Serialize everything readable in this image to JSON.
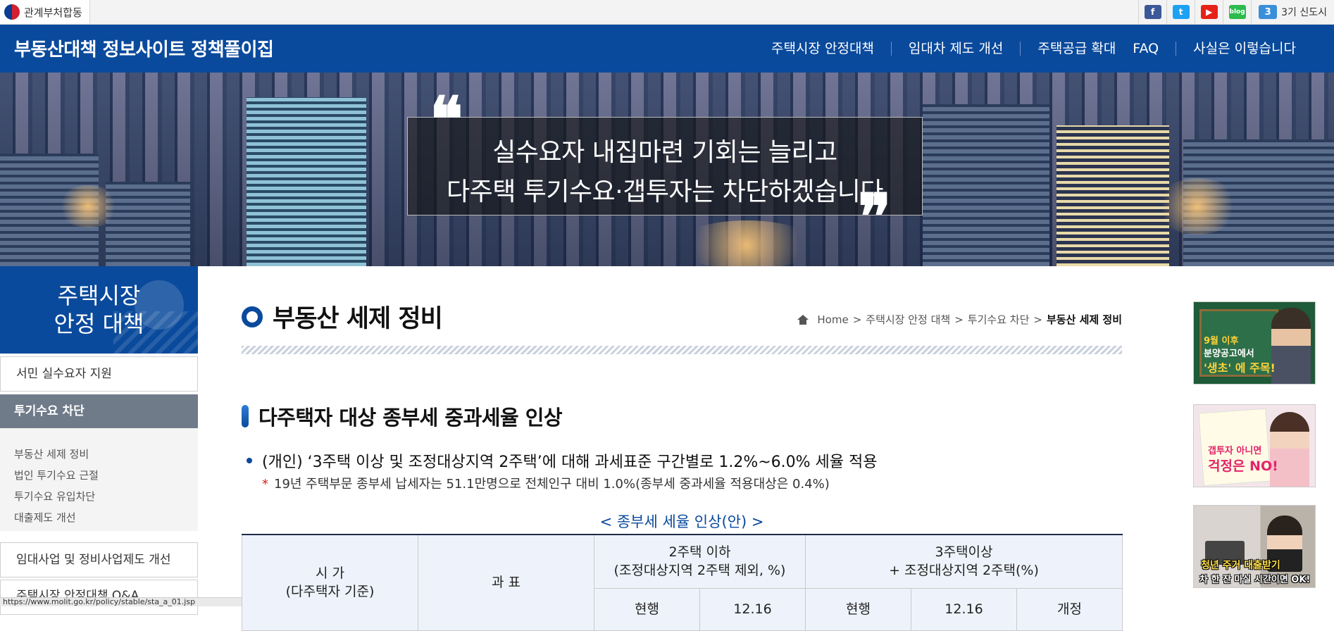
{
  "topbar": {
    "gov_label": "관계부처합동",
    "social": [
      {
        "icon": "facebook-icon",
        "glyph": "f",
        "color": "#3b5998"
      },
      {
        "icon": "twitter-icon",
        "glyph": "t",
        "color": "#1da1f2"
      },
      {
        "icon": "youtube-icon",
        "glyph": "▶",
        "color": "#e62117"
      },
      {
        "icon": "blog-icon",
        "glyph": "blog",
        "color": "#2dba4e"
      }
    ],
    "newcity_num": "3",
    "newcity_label": "3기 신도시"
  },
  "nav": {
    "site_title": "부동산대책 정보사이트 정책풀이집",
    "items": [
      "주택시장 안정대책",
      "임대차 제도 개선",
      "주택공급 확대",
      "FAQ",
      "사실은 이렇습니다"
    ]
  },
  "hero": {
    "line1": "실수요자 내집마련 기회는 늘리고",
    "line2": "다주택 투기수요·갭투자는 차단하겠습니다",
    "quote_open": "❝",
    "quote_close": "❞"
  },
  "lnb": {
    "title": "주택시장\n안정 대책",
    "items": [
      "서민 실수요자 지원",
      "투기수요 차단",
      "임대사업 및 정비사업제도 개선",
      "주택시장 안정대책 Q&A"
    ],
    "sub_items": [
      "부동산 세제 정비",
      "법인 투기수요 근절",
      "투기수요 유입차단",
      "대출제도 개선"
    ]
  },
  "status_url": "https://www.molit.go.kr/policy/stable/sta_a_01.jsp",
  "content": {
    "title": "부동산 세제 정비",
    "breadcrumb": {
      "home": "Home",
      "sep": ">",
      "c1": "주택시장 안정 대책",
      "c2": "투기수요 차단",
      "current": "부동산 세제 정비"
    },
    "section_title": "다주택자 대상 종부세 중과세율 인상",
    "bullet": "(개인) ‘3주택 이상 및 조정대상지역 2주택’에 대해 과세표준 구간별로 1.2%~6.0% 세율 적용",
    "note_star": "*",
    "note": "19년 주택부문 종부세 납세자는 51.1만명으로 전체인구 대비 1.0%(종부세 중과세율 적용대상은 0.4%)",
    "table_caption": "< 종부세 세율 인상(안) >",
    "table": {
      "col_price": "시 가\n(다주택자 기준)",
      "col_base": "과 표",
      "col_group1": "2주택 이하\n(조정대상지역 2주택 제외, %)",
      "col_group2": "3주택이상\n+ 조정대상지역 2주택(%)",
      "sub": [
        "현행",
        "12.16",
        "현행",
        "12.16",
        "개정"
      ]
    }
  },
  "banners": [
    {
      "t1": "9월 이후",
      "t2": "분양공고에서",
      "t3": "'생초' 에 주목!"
    },
    {
      "t1": "갭투자 아니면",
      "t2": "걱정은 NO!"
    },
    {
      "t1": "청년 주거 대출받기",
      "t2": "차 한 잔 마실 시간이면 OK!"
    }
  ]
}
